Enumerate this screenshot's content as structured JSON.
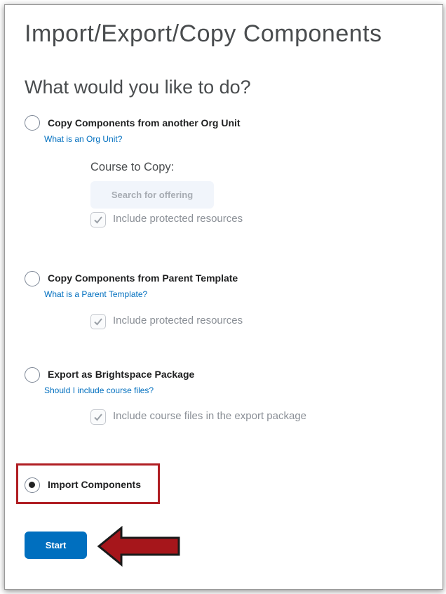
{
  "page": {
    "title": "Import/Export/Copy Components",
    "question": "What would you like to do?"
  },
  "options": [
    {
      "label": "Copy Components from another Org Unit",
      "help_link": "What is an Org Unit?",
      "course_to_copy_label": "Course to Copy:",
      "search_button": "Search for offering",
      "checkbox_label": "Include protected resources",
      "checked": true,
      "selected": false
    },
    {
      "label": "Copy Components from Parent Template",
      "help_link": "What is a Parent Template?",
      "checkbox_label": "Include protected resources",
      "checked": true,
      "selected": false
    },
    {
      "label": "Export as Brightspace Package",
      "help_link": "Should I include course files?",
      "checkbox_label": "Include course files in the export package",
      "checked": true,
      "selected": false
    },
    {
      "label": "Import Components",
      "selected": true
    }
  ],
  "actions": {
    "start_label": "Start"
  },
  "colors": {
    "link": "#006fbf",
    "primary_button": "#006fbf",
    "highlight": "#b01e23",
    "arrow": "#a6161b"
  }
}
